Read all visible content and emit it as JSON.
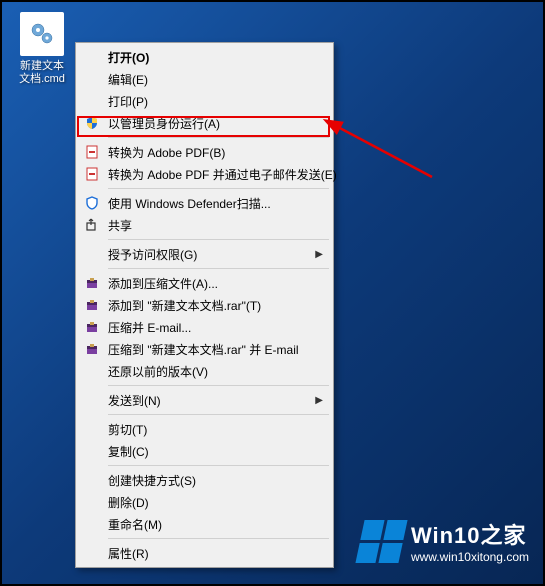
{
  "desktop": {
    "file_label": "新建文本文档.cmd"
  },
  "menu": {
    "open": "打开(O)",
    "edit": "编辑(E)",
    "print": "打印(P)",
    "run_as_admin": "以管理员身份运行(A)",
    "convert_pdf": "转换为 Adobe PDF(B)",
    "convert_pdf_email": "转换为 Adobe PDF 并通过电子邮件发送(E)",
    "defender_scan": "使用 Windows Defender扫描...",
    "share": "共享",
    "grant_access": "授予访问权限(G)",
    "add_to_archive": "添加到压缩文件(A)...",
    "add_to_rar": "添加到 \"新建文本文档.rar\"(T)",
    "compress_email": "压缩并 E-mail...",
    "compress_rar_email": "压缩到 \"新建文本文档.rar\" 并 E-mail",
    "restore_versions": "还原以前的版本(V)",
    "send_to": "发送到(N)",
    "cut": "剪切(T)",
    "copy": "复制(C)",
    "create_shortcut": "创建快捷方式(S)",
    "delete": "删除(D)",
    "rename": "重命名(M)",
    "properties": "属性(R)"
  },
  "watermark": {
    "title": "Win10之家",
    "url": "www.win10xitong.com"
  }
}
